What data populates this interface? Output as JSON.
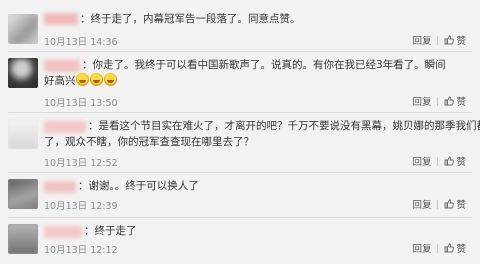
{
  "comments": [
    {
      "text_lines": [
        "：终于走了，内幕冠军告一段落了。同意点赞。"
      ],
      "time": "10月13日 14:36",
      "reply": "回复",
      "like": "赞"
    },
    {
      "text_lines": [
        "：你走了。我终于可以看中国新歌声了。说真的。有你在我已经3年看了。瞬间",
        "好高兴"
      ],
      "time": "10月13日 13:50",
      "reply": "回复",
      "like": "赞"
    },
    {
      "text_lines": [
        "：是看这个节目实在难火了，才离开的吧？千万不要说没有黑幕，姚贝娜的那季我们都看",
        "了，观众不瞎，你的冠军查查现在哪里去了？"
      ],
      "time": "10月13日 12:52",
      "reply": "回复",
      "like": "赞"
    },
    {
      "text_lines": [
        "：谢谢。。终于可以换人了"
      ],
      "time": "10月13日 12:39",
      "reply": "回复",
      "like": "赞"
    },
    {
      "text_lines": [
        "：终于走了"
      ],
      "time": "10月13日 12:12",
      "reply": "回复",
      "like": "赞"
    }
  ],
  "colors": {
    "background": "#f2f2f2",
    "time": "#8c8c8c",
    "divider": "#dcdcdc"
  },
  "icons": [
    "thumb-up-icon",
    "laughing-emoji-icon"
  ]
}
